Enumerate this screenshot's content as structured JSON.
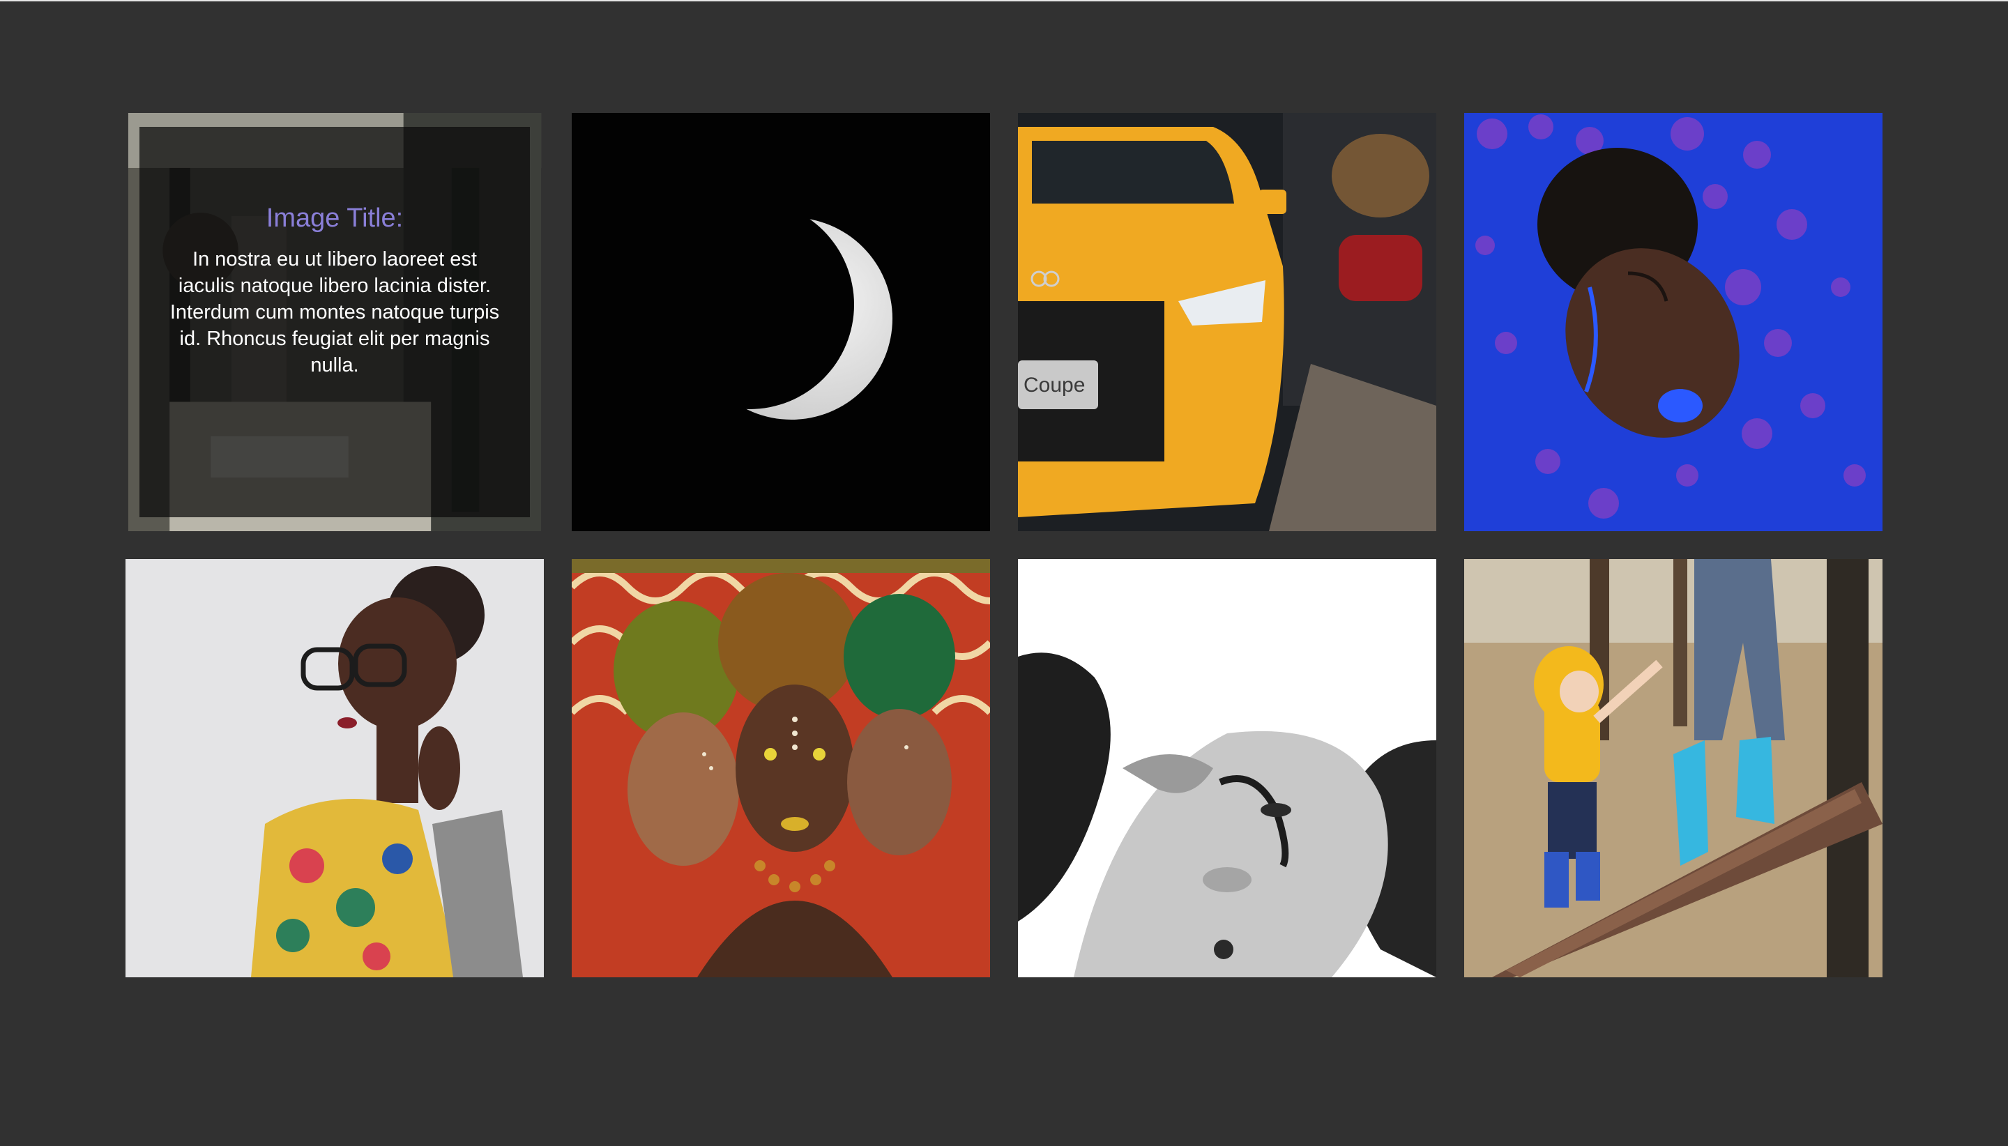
{
  "gallery": {
    "items": [
      {
        "alt": "",
        "overlay": {
          "title": "Image Title:",
          "text": "In nostra eu ut libero laoreet est iaculis natoque libero lacinia dister. Interdum cum montes natoque turpis id. Rhoncus feugiat elit per magnis nulla."
        }
      },
      {
        "alt": ""
      },
      {
        "alt": "",
        "badge_text": "Coupe"
      },
      {
        "alt": ""
      },
      {
        "alt": ""
      },
      {
        "alt": ""
      },
      {
        "alt": ""
      },
      {
        "alt": ""
      }
    ]
  },
  "colors": {
    "background": "#313131",
    "overlay_title": "#8a7fd8",
    "overlay_text": "#ffffff"
  }
}
